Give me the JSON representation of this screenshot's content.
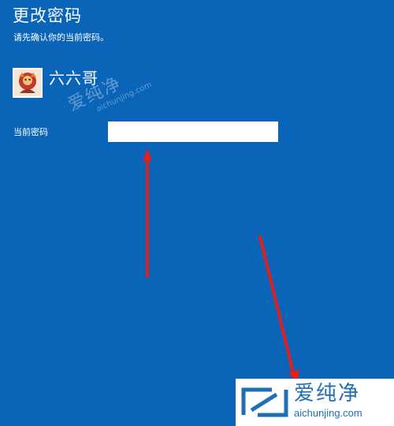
{
  "dialog": {
    "title": "更改密码",
    "subtitle": "请先确认你的当前密码。"
  },
  "account": {
    "username": "六六哥"
  },
  "form": {
    "current_password_label": "当前密码",
    "current_password_value": ""
  },
  "watermark": {
    "logo_text": "爱纯净",
    "url": "aichunjing.com"
  },
  "brand": {
    "name": "爱纯净",
    "url": "aichunjing.com"
  },
  "colors": {
    "background": "#0a64b8",
    "arrow": "#e02020",
    "brand": "#1e6fb8"
  },
  "icons": [
    "avatar-image",
    "arrow-annotation",
    "site-logo-icon"
  ]
}
